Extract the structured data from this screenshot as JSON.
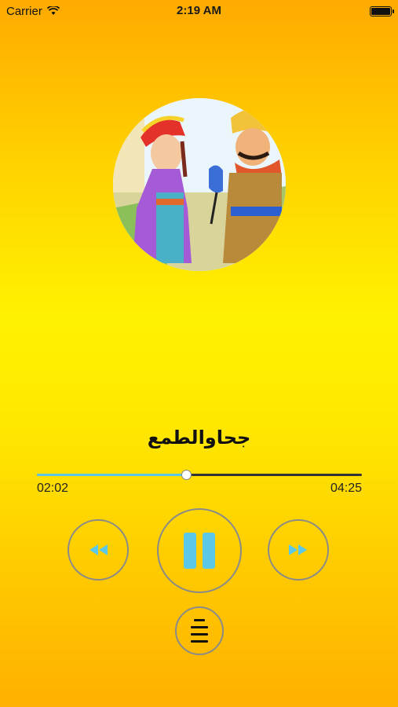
{
  "status_bar": {
    "carrier": "Carrier",
    "time": "2:19 AM",
    "battery_level": 1.0
  },
  "track": {
    "title": "جحاوالطمع",
    "elapsed": "02:02",
    "duration": "04:25",
    "progress": 0.46
  },
  "colors": {
    "accent": "#5BC8E8",
    "background_top": "#FFAA00",
    "background_mid": "#FFF200",
    "control_border": "#8a8a8a"
  },
  "icons": {
    "rewind": "rewind-icon",
    "pause": "pause-icon",
    "forward": "fast-forward-icon",
    "playlist": "playlist-icon",
    "wifi": "wifi-icon",
    "battery": "battery-icon"
  }
}
